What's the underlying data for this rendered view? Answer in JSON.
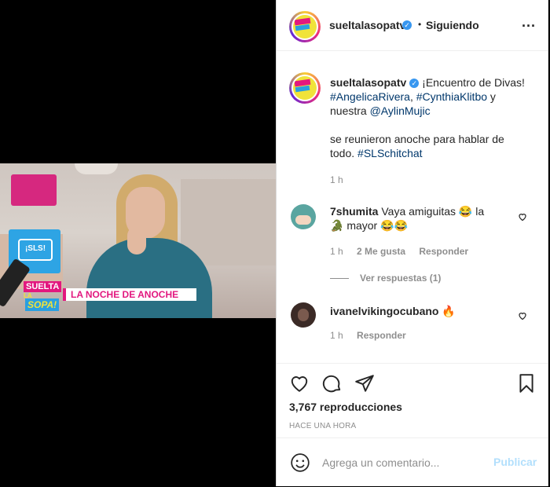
{
  "post_header": {
    "username": "sueltalasopatv",
    "dot": "•",
    "follow_status": "Siguiendo",
    "more": "..."
  },
  "caption": {
    "username": "sueltalasopatv",
    "text1": "¡Encuentro de Divas!",
    "hashtag1": "#AngelicaRivera",
    "sep": ",",
    "hashtag2": "#CynthiaKlitbo",
    "text2": " y",
    "text3": "nuestra ",
    "mention": "@AylinMujic",
    "text4": "se reunieron anoche para hablar de",
    "text5": "todo. ",
    "hashtag3": "#SLSchitchat",
    "time": "1 h"
  },
  "video_overlay": {
    "badge": "¡SLS!",
    "logo_line1": "SUELTA",
    "logo_line2": "LA",
    "logo_line3": "SOPA!",
    "banner": "LA NOCHE DE ANOCHE"
  },
  "comments": [
    {
      "username": "7shumita",
      "text1": "Vaya amiguitas 😂 la",
      "text2": "🐊 mayor 😂😂",
      "time": "1 h",
      "likes": "2 Me gusta",
      "reply": "Responder",
      "view_replies": "Ver respuestas (1)"
    },
    {
      "username": "ivanelvikingocubano",
      "emoji": "🔥",
      "time": "1 h",
      "reply": "Responder"
    }
  ],
  "stats": {
    "views": "3,767 reproducciones",
    "posted": "HACE UNA HORA"
  },
  "add_comment": {
    "placeholder": "Agrega un comentario...",
    "publish": "Publicar"
  },
  "colors": {
    "link": "#00376b",
    "publish_disabled": "#b2dffc",
    "verified": "#3897f0"
  }
}
